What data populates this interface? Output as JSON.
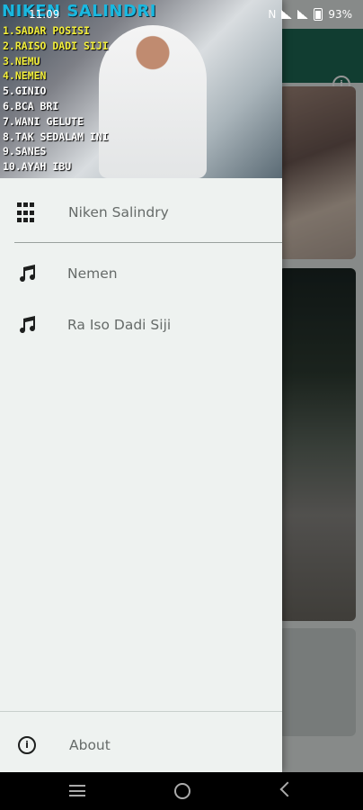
{
  "status_bar": {
    "time": "11.09",
    "network": "N",
    "battery": "93%"
  },
  "drawer": {
    "header": {
      "title": "NIKEN SALINDRI",
      "songs": [
        "1.SADAR POSISI",
        "2.RAISO DADI SIJI",
        "3.NEMU",
        "4.NEMEN",
        "5.GINIO",
        "6.BCA BRI",
        "7.WANI GELUTE",
        "8.TAK SEDALAM INI",
        "9.SANES",
        "10.AYAH IBU"
      ]
    },
    "items": [
      {
        "label": "Niken Salindry",
        "icon": "grid-icon"
      },
      {
        "label": "Nemen",
        "icon": "music-note-icon"
      },
      {
        "label": "Ra Iso Dadi Siji",
        "icon": "music-note-icon"
      }
    ],
    "about": {
      "label": "About",
      "icon": "info-icon"
    }
  },
  "background": {
    "toolbar_icon": "i"
  }
}
